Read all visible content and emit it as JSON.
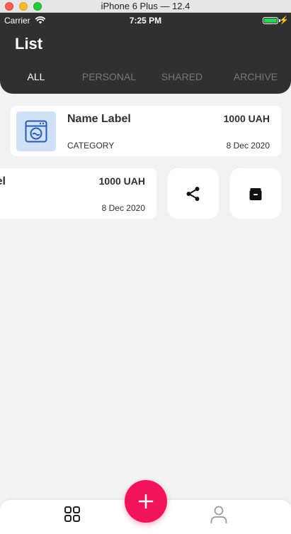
{
  "window": {
    "title": "iPhone 6 Plus — 12.4"
  },
  "status_bar": {
    "carrier": "Carrier",
    "time": "7:25 PM",
    "battery_level": 1.0
  },
  "header": {
    "title": "List",
    "tabs": [
      {
        "label": "ALL",
        "active": true
      },
      {
        "label": "PERSONAL",
        "active": false
      },
      {
        "label": "SHARED",
        "active": false
      },
      {
        "label": "ARCHIVE",
        "active": false
      }
    ]
  },
  "items": [
    {
      "name": "Name Label",
      "amount": "1000 UAH",
      "category": "CATEGORY",
      "date": "8 Dec 2020",
      "icon": "washing-machine-icon"
    },
    {
      "name_partial": "el",
      "amount": "1000 UAH",
      "date": "8 Dec 2020"
    }
  ],
  "swipe_actions": [
    {
      "icon": "share-icon"
    },
    {
      "icon": "archive-icon"
    }
  ],
  "bottom_nav": {
    "items": [
      "grid-icon",
      "user-icon"
    ],
    "fab_icon": "plus-icon"
  },
  "colors": {
    "header": "#303030",
    "accent": "#f0145a",
    "thumb_bg": "#cfe0f7",
    "icon_blue": "#2a5ba8",
    "background": "#f2f2f2"
  }
}
